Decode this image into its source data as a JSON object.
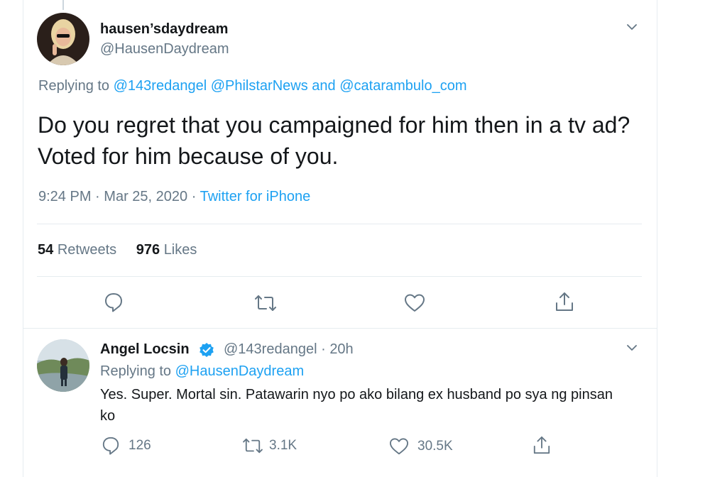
{
  "main_tweet": {
    "display_name": "hausen’sdaydream",
    "handle": "@HausenDaydream",
    "replying_prefix": "Replying to",
    "replying_mentions": [
      "@143redangel",
      "@PhilstarNews",
      "@catarambulo_com"
    ],
    "replying_and": "and",
    "text": "Do you regret that you campaigned for him then in a tv ad? Voted for him because of you.",
    "time": "9:24 PM",
    "date": "Mar 25, 2020",
    "separator": "·",
    "source": "Twitter for iPhone",
    "retweets_count": "54",
    "retweets_label": "Retweets",
    "likes_count": "976",
    "likes_label": "Likes"
  },
  "reply_tweet": {
    "display_name": "Angel Locsin",
    "handle": "@143redangel",
    "separator": "·",
    "age": "20h",
    "replying_prefix": "Replying to",
    "replying_mention": "@HausenDaydream",
    "text": "Yes. Super. Mortal sin. Patawarin nyo po ako bilang ex husband po sya ng pinsan ko",
    "reply_count": "126",
    "retweet_count": "3.1K",
    "like_count": "30.5K"
  },
  "icons": {
    "reply": "reply-icon",
    "retweet": "retweet-icon",
    "like": "heart-icon",
    "share": "share-icon",
    "more": "chevron-down-icon",
    "verified": "verified-badge-icon"
  },
  "colors": {
    "link": "#1da1f2",
    "secondary_text": "#657786",
    "primary_text": "#14171a",
    "divider": "#e6ecf0"
  }
}
